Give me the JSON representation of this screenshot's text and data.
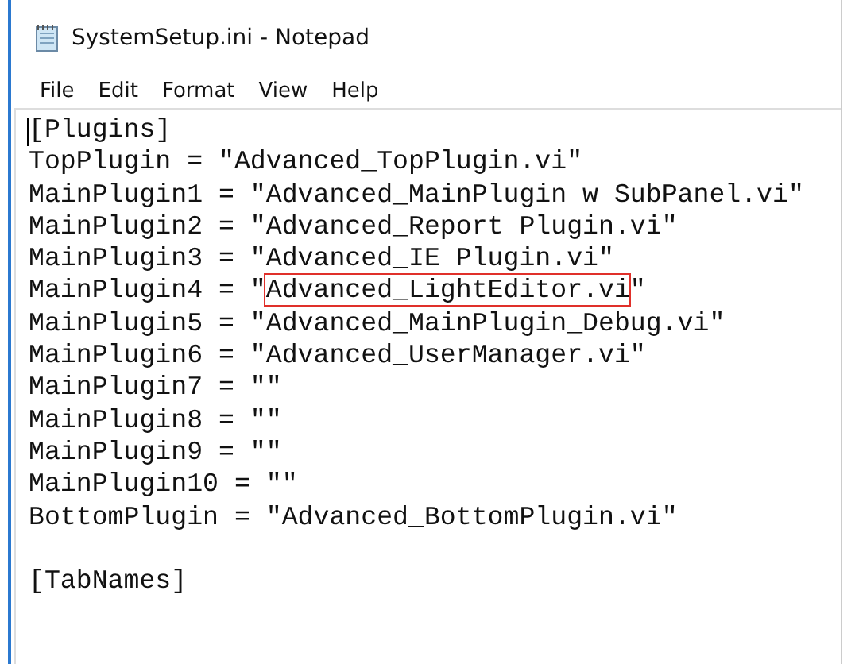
{
  "window": {
    "title": "SystemSetup.ini - Notepad"
  },
  "menu": [
    "File",
    "Edit",
    "Format",
    "View",
    "Help"
  ],
  "lines": [
    {
      "kind": "plain",
      "text": "[Plugins]"
    },
    {
      "kind": "plain",
      "text": "TopPlugin = \"Advanced_TopPlugin.vi\""
    },
    {
      "kind": "plain",
      "text": "MainPlugin1 = \"Advanced_MainPlugin w SubPanel.vi\""
    },
    {
      "kind": "plain",
      "text": "MainPlugin2 = \"Advanced_Report Plugin.vi\""
    },
    {
      "kind": "plain",
      "text": "MainPlugin3 = \"Advanced_IE Plugin.vi\""
    },
    {
      "kind": "highlighted",
      "before": "MainPlugin4 = \"",
      "text": "Advanced_LightEditor.vi",
      "after": "\""
    },
    {
      "kind": "plain",
      "text": "MainPlugin5 = \"Advanced_MainPlugin_Debug.vi\""
    },
    {
      "kind": "plain",
      "text": "MainPlugin6 = \"Advanced_UserManager.vi\""
    },
    {
      "kind": "plain",
      "text": "MainPlugin7 = \"\""
    },
    {
      "kind": "plain",
      "text": "MainPlugin8 = \"\""
    },
    {
      "kind": "plain",
      "text": "MainPlugin9 = \"\""
    },
    {
      "kind": "plain",
      "text": "MainPlugin10 = \"\""
    },
    {
      "kind": "plain",
      "text": "BottomPlugin = \"Advanced_BottomPlugin.vi\""
    },
    {
      "kind": "blank"
    },
    {
      "kind": "plain",
      "text": "[TabNames]"
    }
  ]
}
